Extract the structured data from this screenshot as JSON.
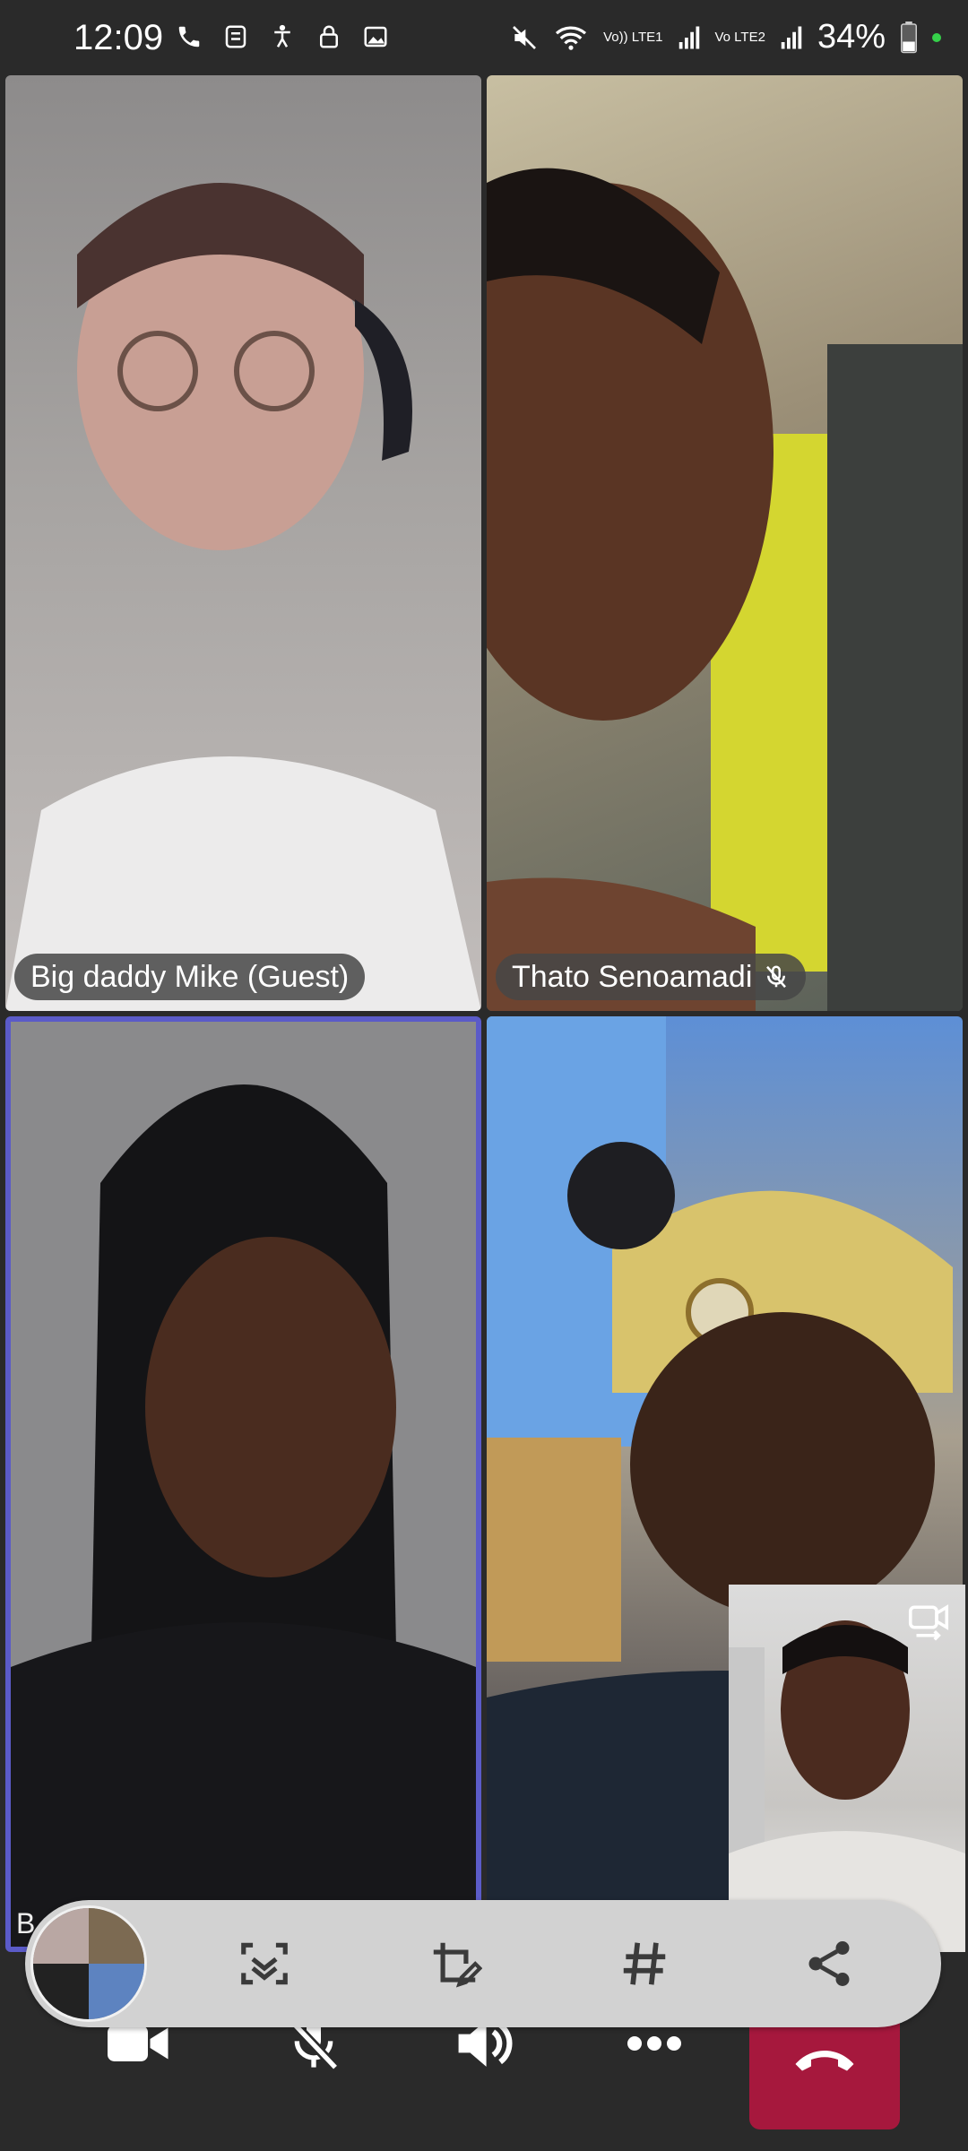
{
  "status_bar": {
    "time": "12:09",
    "battery": "34%",
    "sim1_label": "Vo)) LTE1",
    "sim2_label": "Vo LTE2",
    "icons_left": [
      "phone-icon",
      "voicemail-icon",
      "accessibility-icon",
      "lock-icon",
      "gallery-icon"
    ],
    "icons_right": [
      "mute-icon",
      "wifi-icon",
      "signal-icon",
      "signal-icon",
      "battery-icon"
    ]
  },
  "participants": [
    {
      "name": "Big daddy Mike (Guest)",
      "muted": false
    },
    {
      "name": "Thato Senoamadi",
      "muted": true
    },
    {
      "name": "",
      "muted": false,
      "active_speaker": true
    },
    {
      "name": "",
      "muted": false
    }
  ],
  "tile3_partial_label": "B",
  "toolbar": {
    "items": [
      "gallery-thumbnail",
      "capture-icon",
      "edit-share-icon",
      "hashtag-icon",
      "share-icon"
    ]
  },
  "controls": {
    "items": [
      "video-icon",
      "mic-off-icon",
      "speaker-icon",
      "more-icon",
      "hangup-icon"
    ]
  },
  "colors": {
    "active_speaker_border": "#5b5bc8",
    "hangup": "#a6183d",
    "background": "#2a2a2a"
  }
}
